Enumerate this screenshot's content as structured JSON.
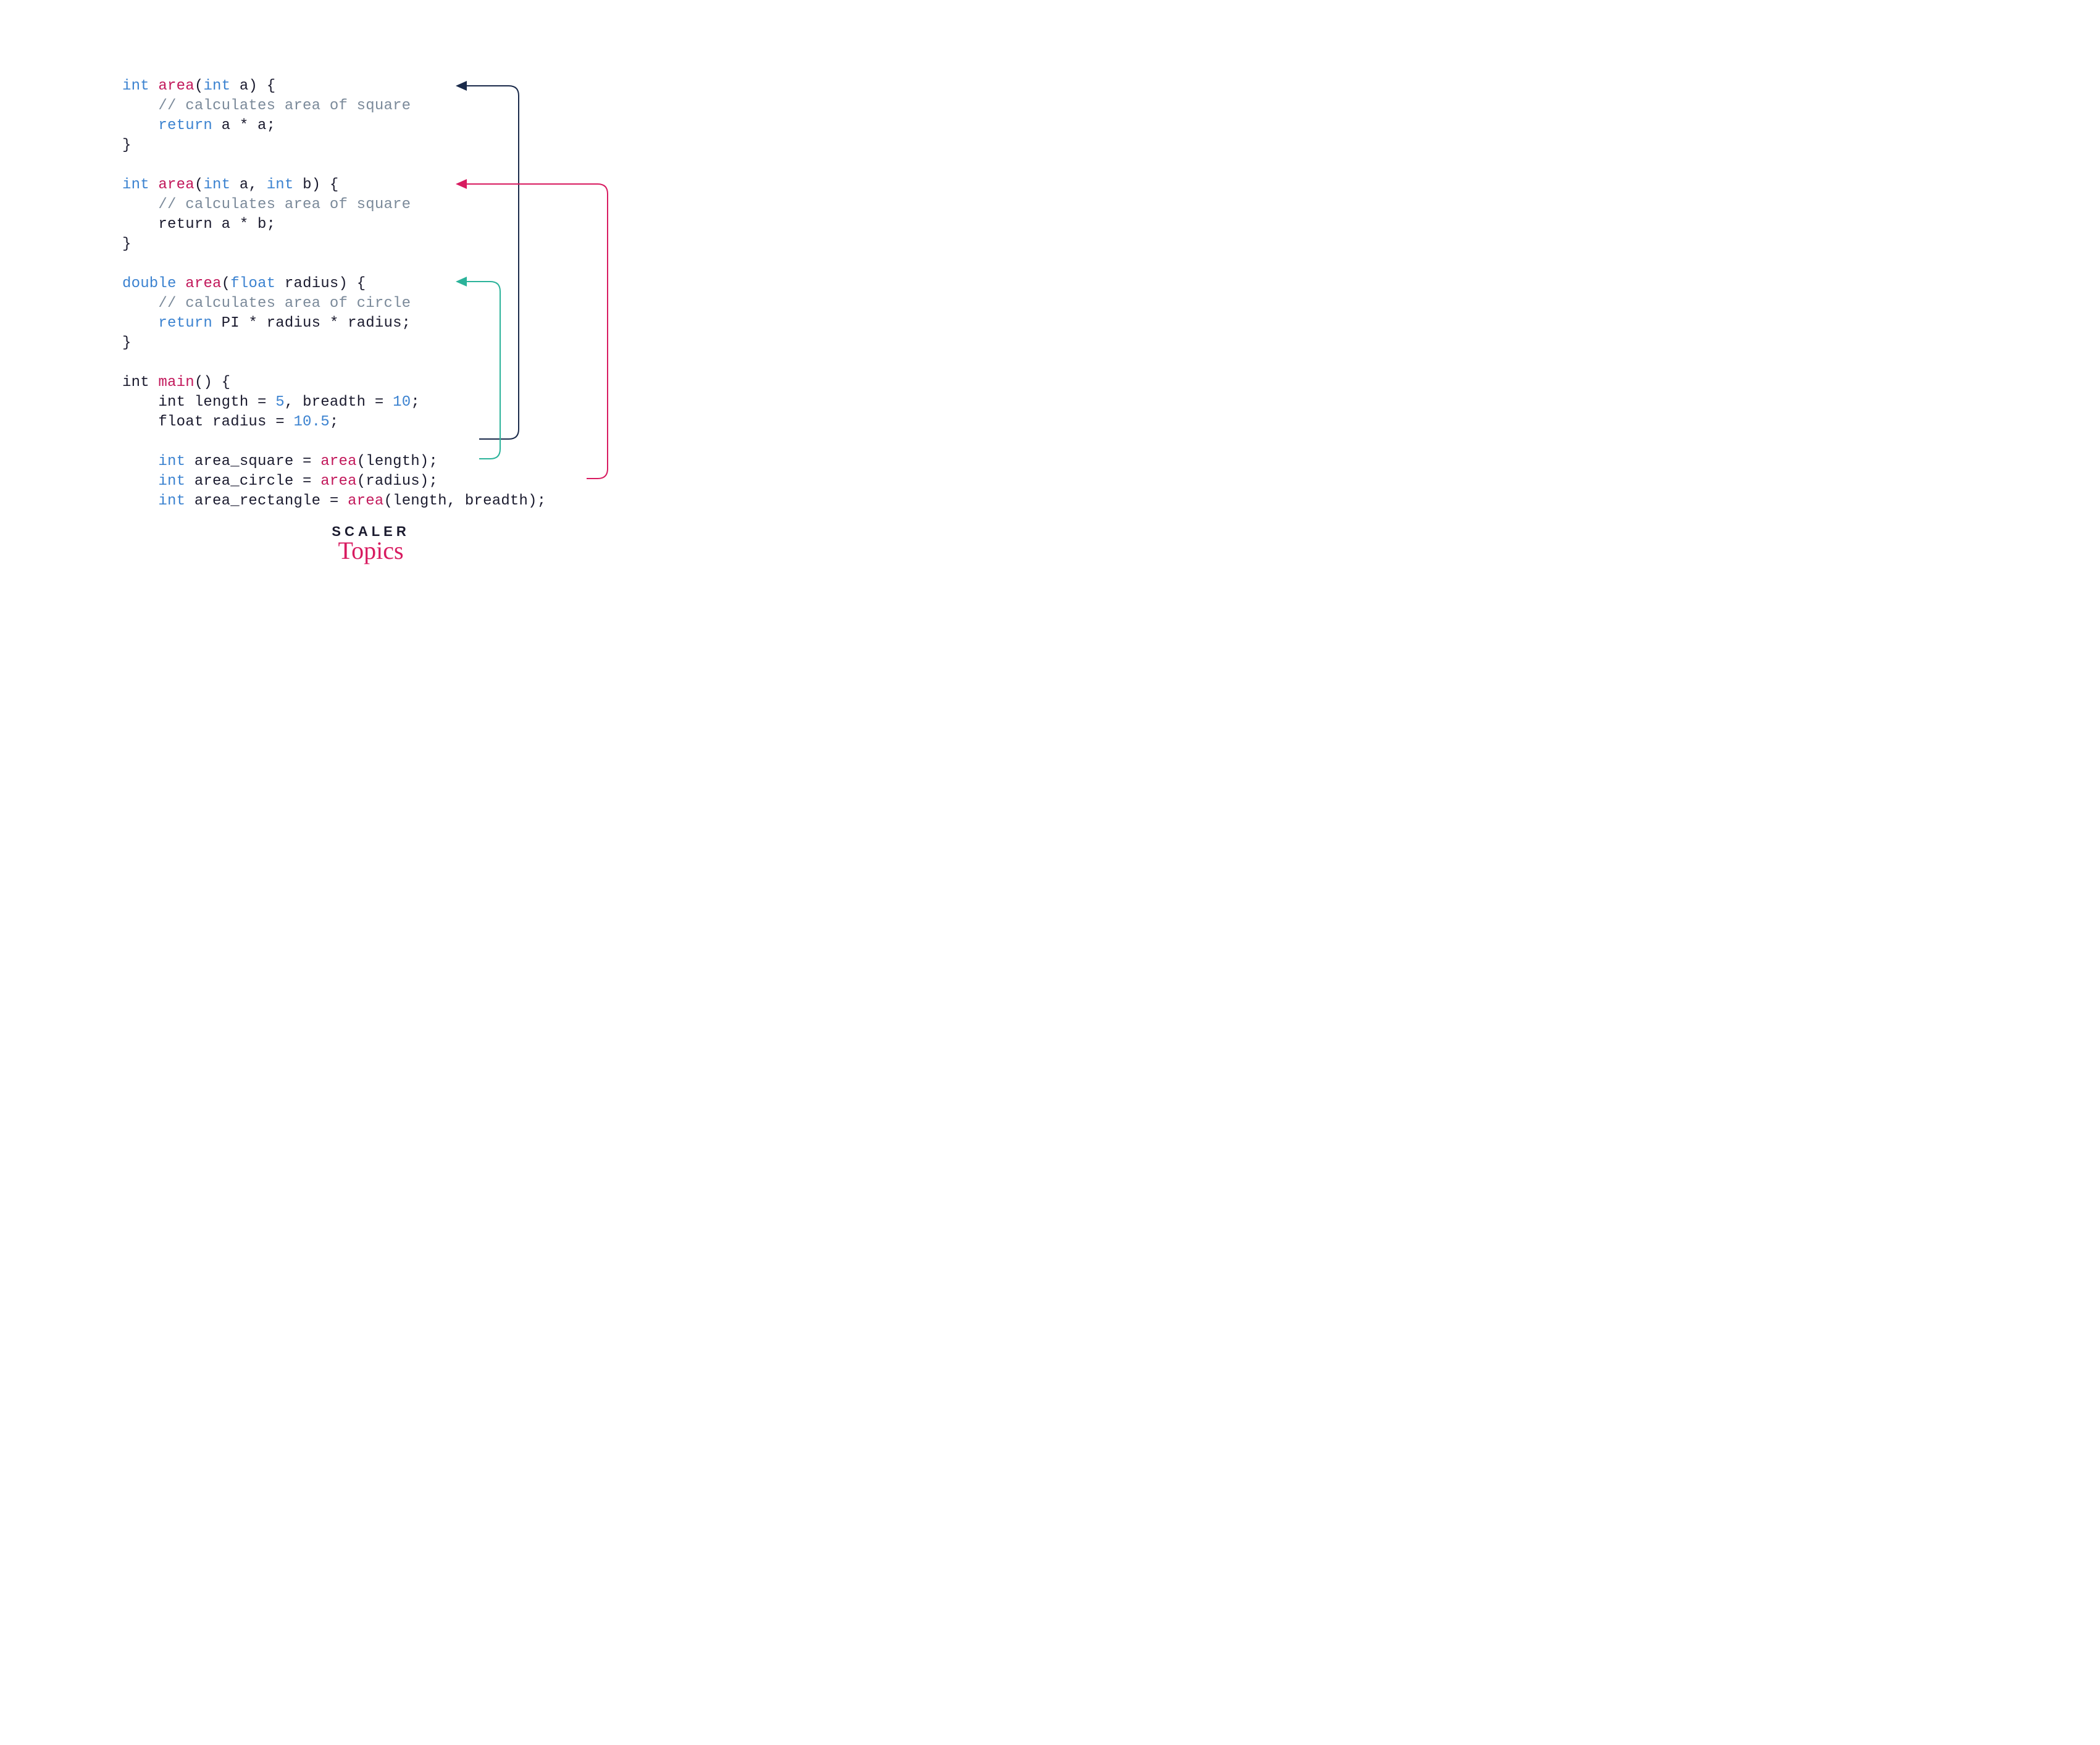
{
  "code": {
    "func1": {
      "sig_kw1": "int",
      "sig_name": "area",
      "sig_open": "(",
      "sig_p1_kw": "int",
      "sig_p1_id": " a",
      "sig_close": ") {",
      "comment": "    // calculates area of square",
      "ret_kw": "    return",
      "ret_expr": " a * a;",
      "close": "}"
    },
    "func2": {
      "sig_kw1": "int",
      "sig_name": "area",
      "sig_open": "(",
      "sig_p1_kw": "int",
      "sig_p1_id": " a, ",
      "sig_p2_kw": "int",
      "sig_p2_id": " b",
      "sig_close": ") {",
      "comment": "    // calculates area of square",
      "ret_line": "    return a * b;",
      "close": "}"
    },
    "func3": {
      "sig_kw1": "double",
      "sig_name": "area",
      "sig_open": "(",
      "sig_p1_kw": "float",
      "sig_p1_id": " radius",
      "sig_close": ") {",
      "comment": "    // calculates area of circle",
      "ret_kw": "    return",
      "ret_expr": " PI * radius * radius;",
      "close": "}"
    },
    "main": {
      "sig_kw1": "int",
      "sig_name": "main",
      "sig_rest": "() {",
      "decl1_a": "    int length = ",
      "decl1_n1": "5",
      "decl1_b": ", breadth = ",
      "decl1_n2": "10",
      "decl1_c": ";",
      "decl2_a": "    float radius = ",
      "decl2_n": "10.5",
      "decl2_b": ";",
      "call1_kw": "    int",
      "call1_a": " area_square = ",
      "call1_fn": "area",
      "call1_b": "(length);",
      "call2_kw": "    int",
      "call2_a": " area_circle = ",
      "call2_fn": "area",
      "call2_b": "(radius);",
      "call3_kw": "    int",
      "call3_a": " area_rectangle = ",
      "call3_fn": "area",
      "call3_b": "(length, breadth);"
    }
  },
  "arrows": {
    "colors": {
      "square": "#1a2a4a",
      "circle": "#2bb39a",
      "rect": "#d81b60"
    }
  },
  "logo": {
    "line1": "SCALER",
    "line2": "Topics"
  }
}
